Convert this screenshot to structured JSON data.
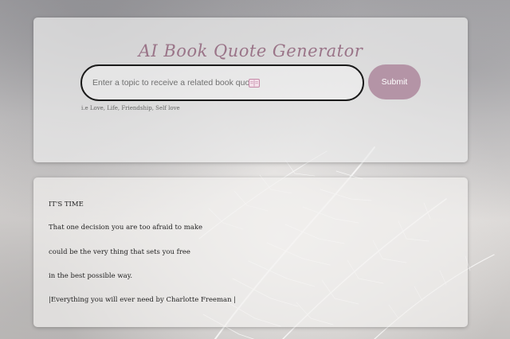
{
  "app": {
    "title": "AI Book Quote Generator"
  },
  "search": {
    "placeholder": "Enter a topic to receive a related book quote",
    "value": "",
    "icon": "open-book-icon"
  },
  "submit": {
    "label": "Submit",
    "color": "#b494a6"
  },
  "hint": "i.e Love, Life, Friendship, Self love",
  "quote": {
    "lines": [
      "IT'S TIME",
      "That one decision you are too afraid to make",
      "could be the very thing that sets you free",
      "in the best possible way.",
      "|Everything you will ever need by Charlotte Freeman |"
    ]
  },
  "colors": {
    "title": "#9a7488",
    "accent": "#b494a6"
  }
}
